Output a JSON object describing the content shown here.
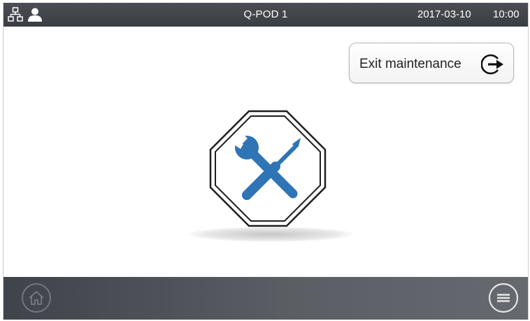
{
  "status_bar": {
    "title": "Q-POD 1",
    "date": "2017-03-10",
    "time": "10:00",
    "icons": [
      "network-icon",
      "user-icon"
    ]
  },
  "exit_button": {
    "label": "Exit maintenance",
    "icon": "exit-icon"
  },
  "main": {
    "symbol_icon": "maintenance-tools-icon"
  },
  "bottom_bar": {
    "icons": [
      "home-icon",
      "menu-icon"
    ]
  },
  "colors": {
    "bar_dark": "#3a3d42",
    "tool_blue": "#2f74b5",
    "white": "#ffffff"
  }
}
